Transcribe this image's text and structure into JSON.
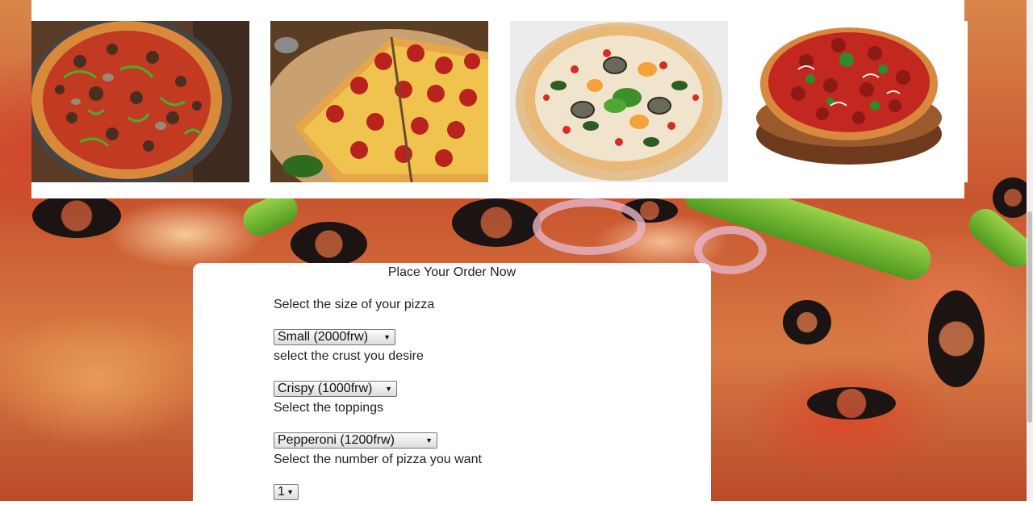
{
  "gallery": {
    "pizzas": [
      {
        "icon": "supreme-pizza-image"
      },
      {
        "icon": "pepperoni-pizza-image"
      },
      {
        "icon": "veggie-pizza-image"
      },
      {
        "icon": "meat-pizza-image"
      }
    ]
  },
  "order_form": {
    "title": "Place Your Order Now",
    "size_label": "Select the size of your pizza",
    "size_value": "Small (2000frw)",
    "crust_label": "select the crust you desire",
    "crust_value": "Crispy (1000frw)",
    "toppings_label": "Select the toppings",
    "toppings_value": "Pepperoni (1200frw)",
    "quantity_label": "Select the number of pizza you want",
    "quantity_value": "1"
  },
  "colors": {
    "panel_background": "#ffffff",
    "text": "#222222"
  }
}
